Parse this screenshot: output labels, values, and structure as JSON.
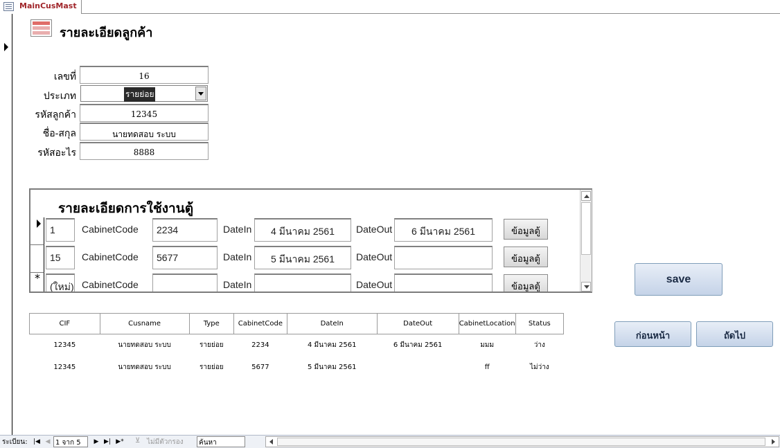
{
  "tab": {
    "label": "MainCusMast",
    "icon": "form-icon"
  },
  "header": {
    "title": "รายละเอียดลูกค้า",
    "icon": "form-icon"
  },
  "fields": [
    {
      "label": "เลขที่",
      "value": "16"
    },
    {
      "label": "ประเภท",
      "value": "รายย่อย"
    },
    {
      "label": "รหัสลูกค้า",
      "value": "12345"
    },
    {
      "label": "ชื่อ-สกุล",
      "value": "นายทดสอบ ระบบ"
    },
    {
      "label": "รหัสอะไร",
      "value": "8888"
    }
  ],
  "subform": {
    "title": "รายละเอียดการใช้งานตู้",
    "labels": {
      "cabinet": "CabinetCode",
      "datein": "DateIn",
      "dateout": "DateOut"
    },
    "button_label": "ข้อมูลตู้",
    "rows": [
      {
        "id": "1",
        "cabinet": "2234",
        "datein": "4 มีนาคม 2561",
        "dateout": "6 มีนาคม 2561"
      },
      {
        "id": "15",
        "cabinet": "5677",
        "datein": "5 มีนาคม 2561",
        "dateout": ""
      },
      {
        "id": "(ใหม่)",
        "cabinet": "",
        "datein": "",
        "dateout": ""
      }
    ]
  },
  "grid": {
    "columns": [
      "CIF",
      "Cusname",
      "Type",
      "CabinetCode",
      "DateIn",
      "DateOut",
      "CabinetLocation",
      "Status"
    ],
    "rows": [
      [
        "12345",
        "นายทดสอบ ระบบ",
        "รายย่อย",
        "2234",
        "4 มีนาคม 2561",
        "6 มีนาคม 2561",
        "มมม",
        "ว่าง"
      ],
      [
        "12345",
        "นายทดสอบ ระบบ",
        "รายย่อย",
        "5677",
        "5 มีนาคม 2561",
        "",
        "ff",
        "ไม่ว่าง"
      ]
    ]
  },
  "buttons": {
    "save": "save",
    "prev": "ก่อนหน้า",
    "next": "ถัดไป"
  },
  "statusbar": {
    "record_label": "ระเบียน:",
    "record_counter": "1 จาก 5",
    "filter_label": "ไม่มีตัวกรอง",
    "search_placeholder": "ค้นหา"
  }
}
